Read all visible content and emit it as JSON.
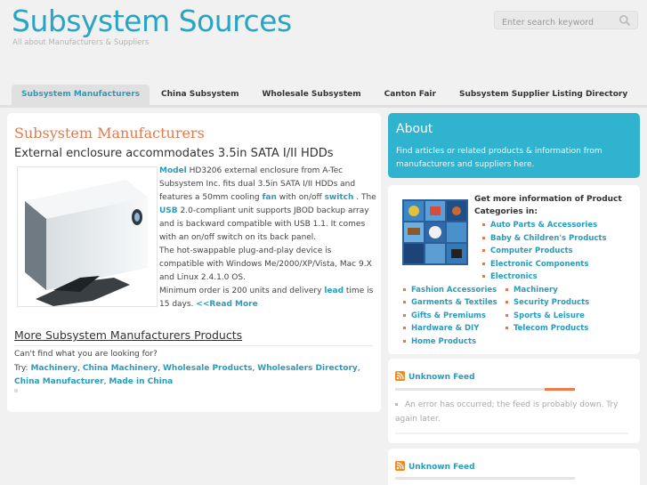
{
  "header": {
    "title": "Subsystem Sources",
    "subtitle": "All about Manufacturers & Suppliers",
    "search_placeholder": "Enter search keyword"
  },
  "nav": {
    "items": [
      {
        "label": "Subsystem Manufacturers",
        "active": true
      },
      {
        "label": "China Subsystem",
        "active": false
      },
      {
        "label": "Wholesale Subsystem",
        "active": false
      },
      {
        "label": "Canton Fair",
        "active": false
      },
      {
        "label": "Subsystem Supplier Listing Directory",
        "active": false
      }
    ]
  },
  "main": {
    "heading": "Subsystem Manufacturers",
    "article_title": "External enclosure accommodates 3.5in SATA I/II HDDs",
    "article": {
      "kw_model": "Model",
      "t1": " HD3206 external enclosure from A-Tec Subsystem Inc. fits dual 3.5in SATA I/II HDDs and features a 50mm cooling ",
      "kw_fan": "fan",
      "t2": " with on/off ",
      "kw_switch": "switch",
      "t3": " . The ",
      "kw_usb": "USB",
      "t4": " 2.0-compliant unit supports JBOD backup array and is backward compatible with USB 1.1. It comes with an on/off switch on its back panel.",
      "t5": "The hot-swappable plug-and-play device is compatible with Windows Me/2000/XP/Vista, Mac 9.X and Linux 2.4.1.0 OS.",
      "t6": "Minimum order is 200 units and delivery ",
      "kw_lead": "lead",
      "t7": " time is 15 days. ",
      "read_more": "<<Read More"
    },
    "more_title": "More Subsystem Manufacturers Products",
    "more_question": "Can't find what you are looking for?",
    "try_label": "Try: ",
    "try_links": [
      "Machinery",
      "China Machinery",
      "Wholesale Products",
      "Wholesalers Directory",
      "China Manufacturer",
      "Made in China"
    ]
  },
  "about": {
    "title": "About",
    "text": "Find articles or related products & information from manufacturers and suppliers here."
  },
  "categories": {
    "heading": "Get more information of Product Categories in:",
    "items": [
      "Auto Parts & Accessories",
      "Baby & Children's Products",
      "Computer Products",
      "Electronic Components",
      "Electronics",
      "Fashion Accessories",
      "Machinery",
      "Garments & Textiles",
      "Security Products",
      "Gifts & Premiums",
      "Sports & Leisure",
      "Hardware & DIY",
      "Telecom Products",
      "Home Products"
    ]
  },
  "feeds": [
    {
      "title": "Unknown Feed",
      "message": "An error has occurred; the feed is probably down. Try again later."
    },
    {
      "title": "Unknown Feed"
    }
  ],
  "colors": {
    "accent": "#27a5c2",
    "heading_orange": "#e07a4e",
    "about_bg": "#2fb3cf"
  }
}
